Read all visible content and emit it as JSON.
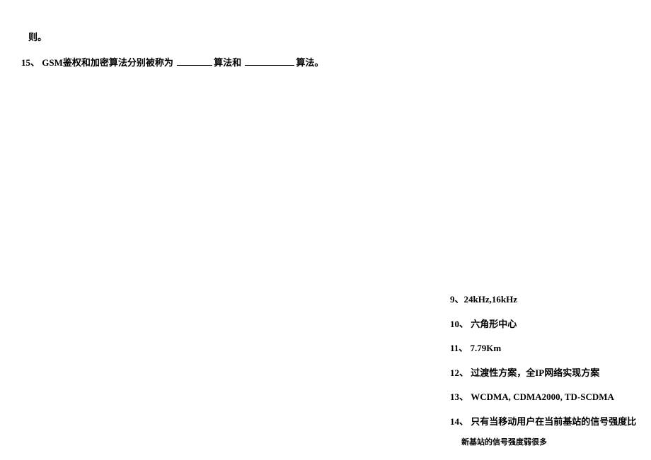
{
  "top": {
    "fragment": "则。",
    "q15_prefix": "15、  GSM鉴权和加密算法分别被称为  ",
    "q15_mid": "算法和  ",
    "q15_suffix": "算法。"
  },
  "answers": {
    "a9": "9、24kHz,16kHz",
    "a10": "10、  六角形中心",
    "a11": "11、  7.79Km",
    "a12": "12、  过渡性方案，全IP网络实现方案",
    "a13": "13、  WCDMA, CDMA2000, TD-SCDMA",
    "a14": "14、  只有当移动用户在当前基站的信号强度比",
    "a14_cont": "新基站的信号强度弱很多"
  }
}
